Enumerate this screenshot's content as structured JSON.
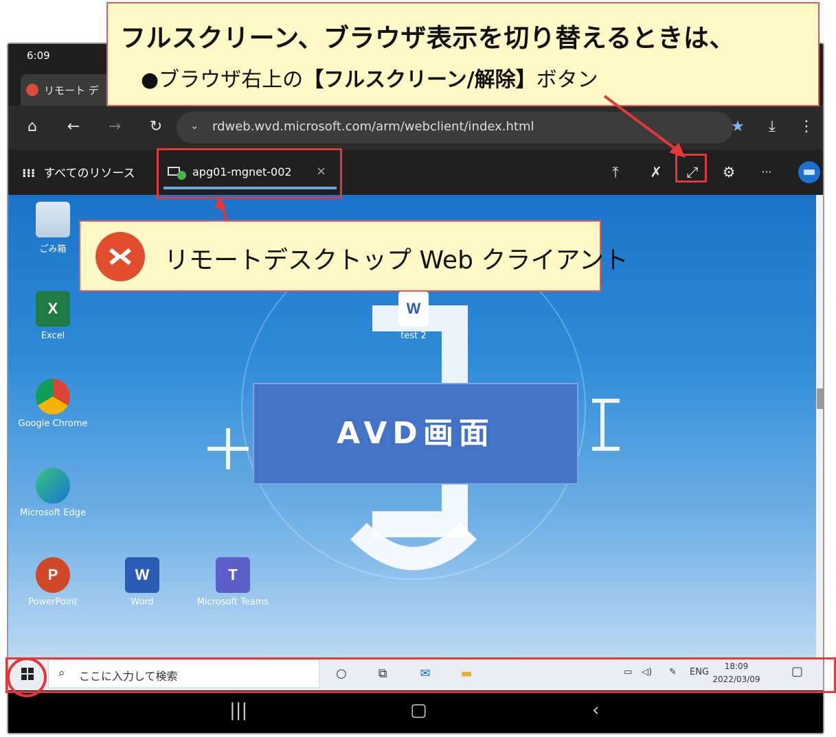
{
  "status": {
    "time": "6:09"
  },
  "browser": {
    "tab_label": "リモート デ",
    "url": "rdweb.wvd.microsoft.com/arm/webclient/index.html"
  },
  "rdclient": {
    "all_resources": "すべてのリソース",
    "session_tab": "apg01-mgnet-002",
    "more": "···"
  },
  "desktop": {
    "icons": {
      "recycle": "ごみ箱",
      "excel": "Excel",
      "test2": "test 2",
      "chrome": "Google Chrome",
      "edge": "Microsoft Edge",
      "powerpoint": "PowerPoint",
      "word": "Word",
      "teams": "Microsoft Teams"
    }
  },
  "taskbar": {
    "search_placeholder": "ここに入力して検索",
    "lang": "ENG",
    "time": "18:09",
    "date": "2022/03/09"
  },
  "callouts": {
    "fullscreen_heading": "フルスクリーン、ブラウザ表示を切り替えるときは、",
    "fullscreen_sub_prefix": "●ブラウザ右上の",
    "fullscreen_sub_bold": "【フルスクリーン/解除】",
    "fullscreen_sub_suffix": "ボタン",
    "client_label": "リモートデスクトップ Web クライアント",
    "avd_label": "AVD画面"
  },
  "colors": {
    "callout_bg": "#fff8c7",
    "highlight": "#e2383a",
    "avd_box": "#4472c4"
  }
}
